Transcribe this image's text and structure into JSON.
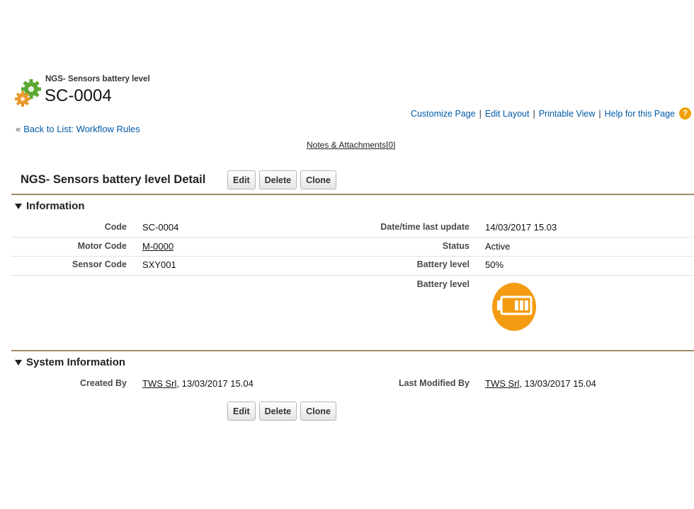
{
  "header": {
    "object_label": "NGS- Sensors battery level",
    "record_name": "SC-0004",
    "icon": "gears-icon"
  },
  "top_links": {
    "customize_page": "Customize Page",
    "edit_layout": "Edit Layout",
    "printable_view": "Printable View",
    "help": "Help for this Page",
    "help_icon": "?"
  },
  "back_link": {
    "prefix": "«",
    "label": "Back to List: Workflow Rules"
  },
  "related": {
    "notes_label": "Notes & Attachments",
    "notes_count": "[0]"
  },
  "detail": {
    "title": "NGS- Sensors battery level Detail",
    "buttons": {
      "edit": "Edit",
      "delete": "Delete",
      "clone": "Clone"
    }
  },
  "information": {
    "heading": "Information",
    "code_label": "Code",
    "code_value": "SC-0004",
    "motor_code_label": "Motor Code",
    "motor_code_value": "M-0000",
    "sensor_code_label": "Sensor Code",
    "sensor_code_value": "SXY001",
    "last_update_label": "Date/time last update",
    "last_update_value": "14/03/2017 15.03",
    "status_label": "Status",
    "status_value": "Active",
    "battery_label": "Battery level",
    "battery_value": "50%",
    "battery_image_label": "Battery level",
    "battery_color": "#f39c12"
  },
  "system_information": {
    "heading": "System Information",
    "created_by_label": "Created By",
    "created_by_user": "TWS Srl",
    "created_by_date": ", 13/03/2017 15.04",
    "last_modified_label": "Last Modified By",
    "last_modified_user": "TWS Srl",
    "last_modified_date": ", 13/03/2017 15.04"
  }
}
